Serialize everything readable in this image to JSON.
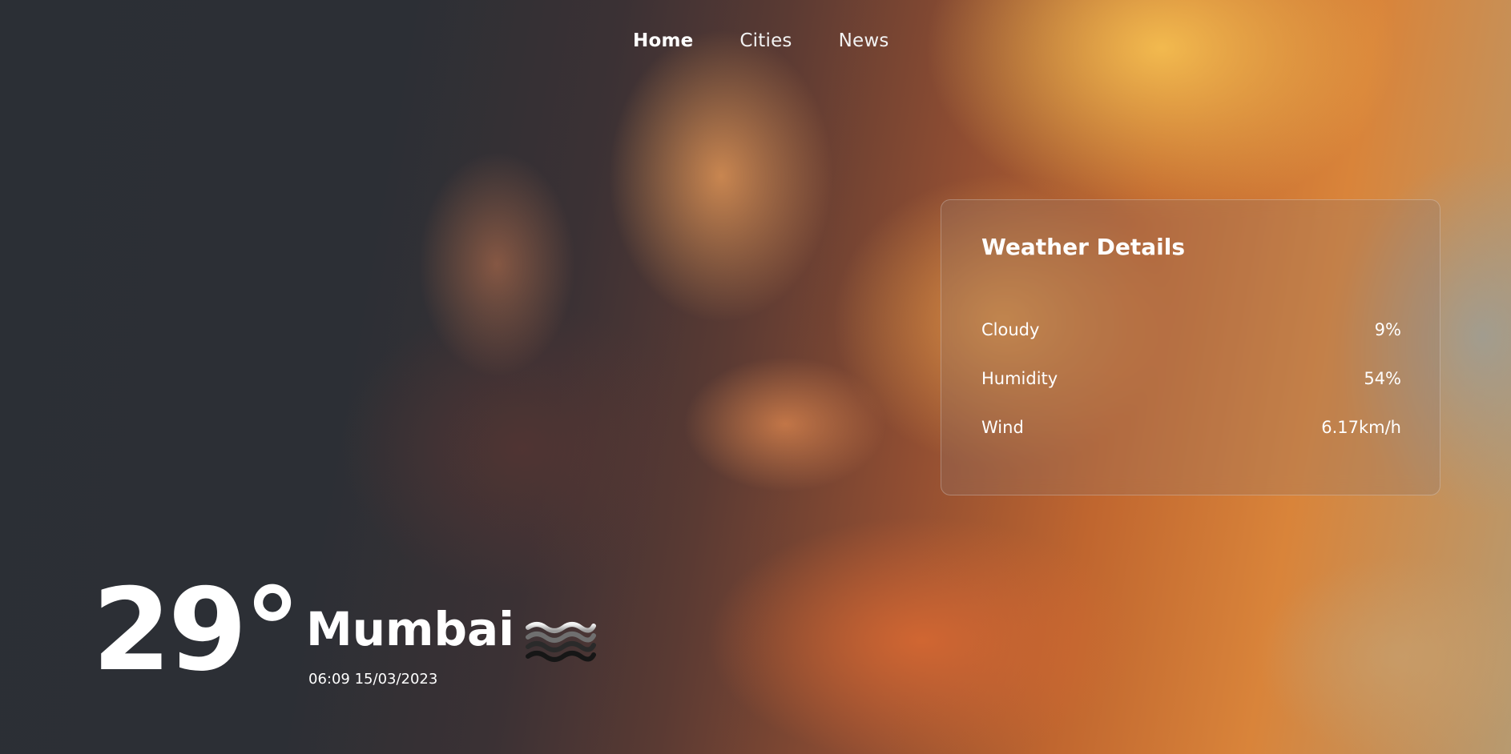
{
  "nav": {
    "items": [
      {
        "label": "Home",
        "active": true
      },
      {
        "label": "Cities",
        "active": false
      },
      {
        "label": "News",
        "active": false
      }
    ]
  },
  "details": {
    "title": "Weather Details",
    "rows": [
      {
        "label": "Cloudy",
        "value": "9%"
      },
      {
        "label": "Humidity",
        "value": "54%"
      },
      {
        "label": "Wind",
        "value": "6.17km/h"
      }
    ]
  },
  "current": {
    "temperature": "29°",
    "city": "Mumbai",
    "datetime": "06:09 15/03/2023",
    "condition_icon": "mist-icon"
  },
  "colors": {
    "text": "#ffffff",
    "panel_border": "#ffffff"
  }
}
